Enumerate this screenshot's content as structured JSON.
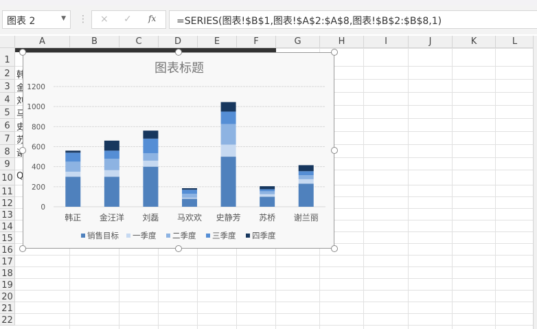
{
  "formula_bar": {
    "name_box": "图表 2",
    "cancel_icon": "×",
    "enter_icon": "✓",
    "fx_label": "fx",
    "formula": "=SERIES(图表!$B$1,图表!$A$2:$A$8,图表!$B$2:$B$8,1)"
  },
  "columns": [
    "A",
    "B",
    "C",
    "D",
    "E",
    "F",
    "G",
    "H",
    "I",
    "J",
    "K",
    "L"
  ],
  "rows": [
    "1",
    "2",
    "3",
    "4",
    "5",
    "6",
    "7",
    "8",
    "9",
    "10",
    "11",
    "12",
    "13",
    "14",
    "15",
    "16",
    "17",
    "18",
    "19",
    "20",
    "21",
    "22"
  ],
  "cells_A": [
    "韩",
    "金",
    "刘",
    "马",
    "史",
    "苏",
    "谢",
    "",
    "Q"
  ],
  "chart_data": {
    "type": "bar",
    "stacked": true,
    "title": "图表标题",
    "categories": [
      "韩正",
      "金汪洋",
      "刘磊",
      "马欢欢",
      "史静芳",
      "苏桥",
      "谢兰丽"
    ],
    "series": [
      {
        "name": "销售目标",
        "color": "#4f81bd",
        "values": [
          300,
          300,
          400,
          80,
          500,
          100,
          230
        ]
      },
      {
        "name": "一季度",
        "color": "#c6d9f1",
        "values": [
          50,
          65,
          60,
          10,
          120,
          25,
          45
        ]
      },
      {
        "name": "二季度",
        "color": "#8db3e2",
        "values": [
          100,
          115,
          75,
          40,
          205,
          30,
          40
        ]
      },
      {
        "name": "三季度",
        "color": "#558ed5",
        "values": [
          90,
          80,
          145,
          40,
          125,
          20,
          40
        ]
      },
      {
        "name": "四季度",
        "color": "#17375e",
        "values": [
          20,
          100,
          80,
          15,
          95,
          30,
          60
        ]
      }
    ],
    "ylim": [
      0,
      1200
    ],
    "yticks": [
      "0",
      "200",
      "400",
      "600",
      "800",
      "1000",
      "1200"
    ],
    "grid": true,
    "legend": "bottom"
  }
}
